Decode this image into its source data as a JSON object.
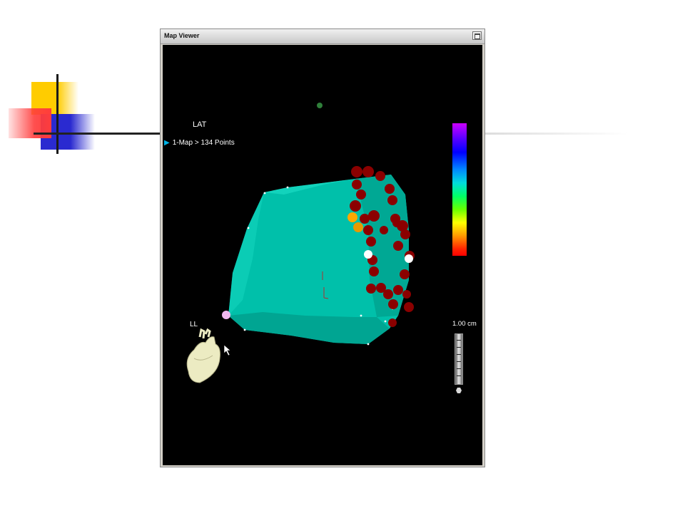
{
  "window": {
    "title": "Map Viewer",
    "maximize_icon": "maximize-icon"
  },
  "viewer": {
    "map_type": "LAT",
    "map_label": "1-Map > 134 Points",
    "orientation": "LL",
    "scale_label": "1.00 cm",
    "background": "#000000",
    "surface_color": "#00c3ad",
    "point_color": "#8b0000",
    "colorbar_icon": "lat-color-scale",
    "orientation_icon": "heart-orientation-icon",
    "cursor_icon": "mouse-cursor-icon"
  }
}
